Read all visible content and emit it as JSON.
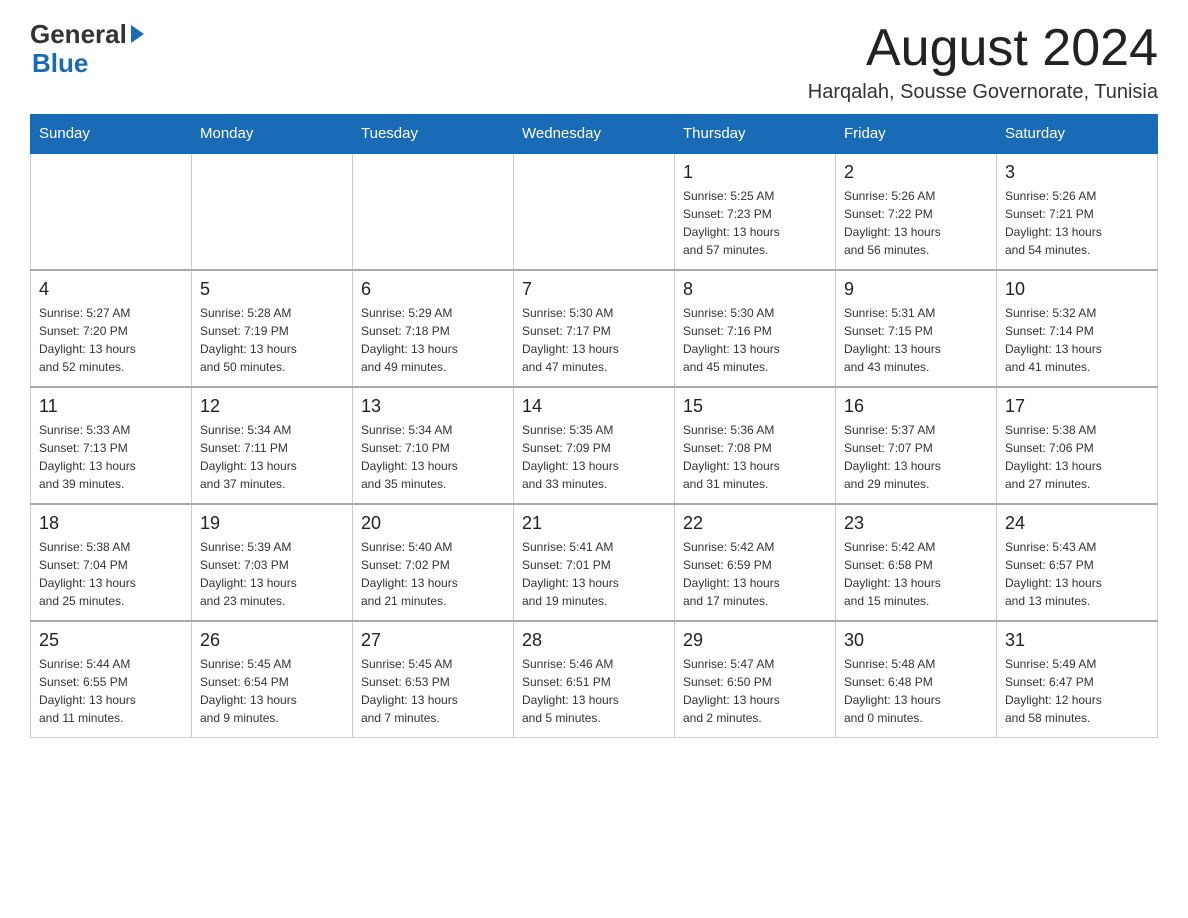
{
  "header": {
    "logo": {
      "general": "General",
      "blue": "Blue"
    },
    "month_year": "August 2024",
    "location": "Harqalah, Sousse Governorate, Tunisia"
  },
  "weekdays": [
    "Sunday",
    "Monday",
    "Tuesday",
    "Wednesday",
    "Thursday",
    "Friday",
    "Saturday"
  ],
  "weeks": [
    [
      {
        "day": "",
        "info": ""
      },
      {
        "day": "",
        "info": ""
      },
      {
        "day": "",
        "info": ""
      },
      {
        "day": "",
        "info": ""
      },
      {
        "day": "1",
        "info": "Sunrise: 5:25 AM\nSunset: 7:23 PM\nDaylight: 13 hours\nand 57 minutes."
      },
      {
        "day": "2",
        "info": "Sunrise: 5:26 AM\nSunset: 7:22 PM\nDaylight: 13 hours\nand 56 minutes."
      },
      {
        "day": "3",
        "info": "Sunrise: 5:26 AM\nSunset: 7:21 PM\nDaylight: 13 hours\nand 54 minutes."
      }
    ],
    [
      {
        "day": "4",
        "info": "Sunrise: 5:27 AM\nSunset: 7:20 PM\nDaylight: 13 hours\nand 52 minutes."
      },
      {
        "day": "5",
        "info": "Sunrise: 5:28 AM\nSunset: 7:19 PM\nDaylight: 13 hours\nand 50 minutes."
      },
      {
        "day": "6",
        "info": "Sunrise: 5:29 AM\nSunset: 7:18 PM\nDaylight: 13 hours\nand 49 minutes."
      },
      {
        "day": "7",
        "info": "Sunrise: 5:30 AM\nSunset: 7:17 PM\nDaylight: 13 hours\nand 47 minutes."
      },
      {
        "day": "8",
        "info": "Sunrise: 5:30 AM\nSunset: 7:16 PM\nDaylight: 13 hours\nand 45 minutes."
      },
      {
        "day": "9",
        "info": "Sunrise: 5:31 AM\nSunset: 7:15 PM\nDaylight: 13 hours\nand 43 minutes."
      },
      {
        "day": "10",
        "info": "Sunrise: 5:32 AM\nSunset: 7:14 PM\nDaylight: 13 hours\nand 41 minutes."
      }
    ],
    [
      {
        "day": "11",
        "info": "Sunrise: 5:33 AM\nSunset: 7:13 PM\nDaylight: 13 hours\nand 39 minutes."
      },
      {
        "day": "12",
        "info": "Sunrise: 5:34 AM\nSunset: 7:11 PM\nDaylight: 13 hours\nand 37 minutes."
      },
      {
        "day": "13",
        "info": "Sunrise: 5:34 AM\nSunset: 7:10 PM\nDaylight: 13 hours\nand 35 minutes."
      },
      {
        "day": "14",
        "info": "Sunrise: 5:35 AM\nSunset: 7:09 PM\nDaylight: 13 hours\nand 33 minutes."
      },
      {
        "day": "15",
        "info": "Sunrise: 5:36 AM\nSunset: 7:08 PM\nDaylight: 13 hours\nand 31 minutes."
      },
      {
        "day": "16",
        "info": "Sunrise: 5:37 AM\nSunset: 7:07 PM\nDaylight: 13 hours\nand 29 minutes."
      },
      {
        "day": "17",
        "info": "Sunrise: 5:38 AM\nSunset: 7:06 PM\nDaylight: 13 hours\nand 27 minutes."
      }
    ],
    [
      {
        "day": "18",
        "info": "Sunrise: 5:38 AM\nSunset: 7:04 PM\nDaylight: 13 hours\nand 25 minutes."
      },
      {
        "day": "19",
        "info": "Sunrise: 5:39 AM\nSunset: 7:03 PM\nDaylight: 13 hours\nand 23 minutes."
      },
      {
        "day": "20",
        "info": "Sunrise: 5:40 AM\nSunset: 7:02 PM\nDaylight: 13 hours\nand 21 minutes."
      },
      {
        "day": "21",
        "info": "Sunrise: 5:41 AM\nSunset: 7:01 PM\nDaylight: 13 hours\nand 19 minutes."
      },
      {
        "day": "22",
        "info": "Sunrise: 5:42 AM\nSunset: 6:59 PM\nDaylight: 13 hours\nand 17 minutes."
      },
      {
        "day": "23",
        "info": "Sunrise: 5:42 AM\nSunset: 6:58 PM\nDaylight: 13 hours\nand 15 minutes."
      },
      {
        "day": "24",
        "info": "Sunrise: 5:43 AM\nSunset: 6:57 PM\nDaylight: 13 hours\nand 13 minutes."
      }
    ],
    [
      {
        "day": "25",
        "info": "Sunrise: 5:44 AM\nSunset: 6:55 PM\nDaylight: 13 hours\nand 11 minutes."
      },
      {
        "day": "26",
        "info": "Sunrise: 5:45 AM\nSunset: 6:54 PM\nDaylight: 13 hours\nand 9 minutes."
      },
      {
        "day": "27",
        "info": "Sunrise: 5:45 AM\nSunset: 6:53 PM\nDaylight: 13 hours\nand 7 minutes."
      },
      {
        "day": "28",
        "info": "Sunrise: 5:46 AM\nSunset: 6:51 PM\nDaylight: 13 hours\nand 5 minutes."
      },
      {
        "day": "29",
        "info": "Sunrise: 5:47 AM\nSunset: 6:50 PM\nDaylight: 13 hours\nand 2 minutes."
      },
      {
        "day": "30",
        "info": "Sunrise: 5:48 AM\nSunset: 6:48 PM\nDaylight: 13 hours\nand 0 minutes."
      },
      {
        "day": "31",
        "info": "Sunrise: 5:49 AM\nSunset: 6:47 PM\nDaylight: 12 hours\nand 58 minutes."
      }
    ]
  ]
}
